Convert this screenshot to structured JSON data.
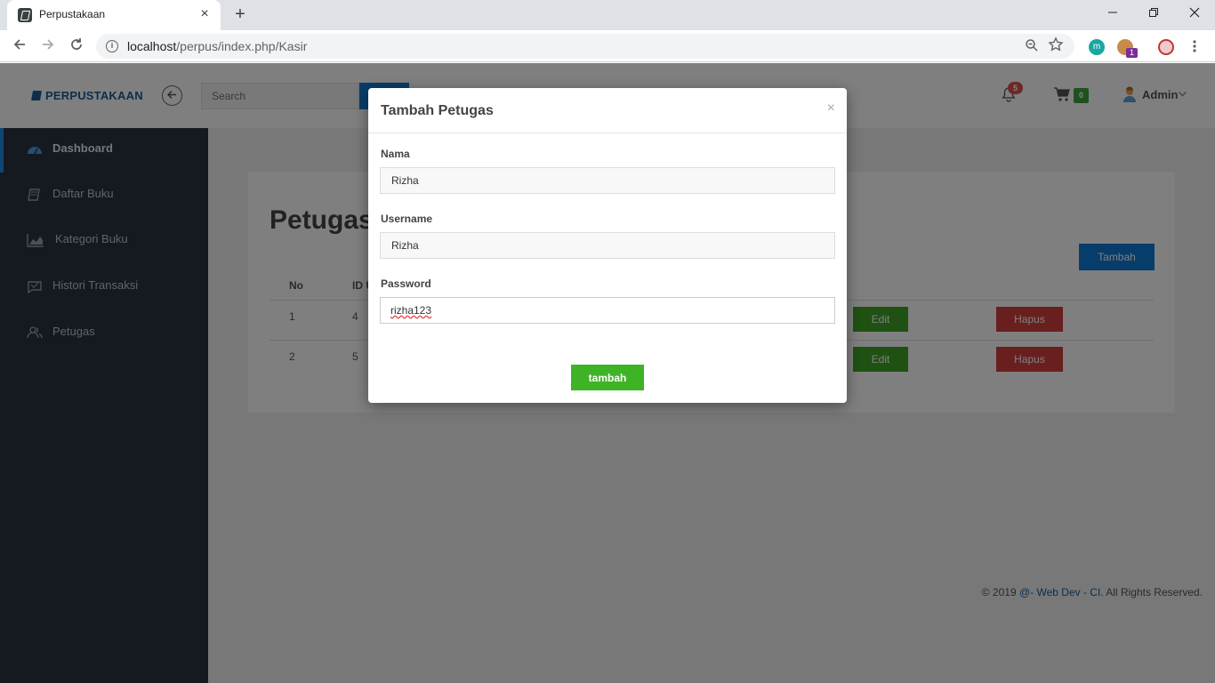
{
  "browser": {
    "tab_title": "Perpustakaan",
    "tab_close": "×",
    "new_tab": "+",
    "url_host": "localhost",
    "url_path": "/perpus/index.php/Kasir",
    "extension_badge": "1",
    "extension_letter": "m"
  },
  "header": {
    "brand": "PERPUSTAKAAN",
    "search_placeholder": "Search",
    "notification_count": "5",
    "cart_count": "0",
    "user_name": "Admin"
  },
  "sidebar": {
    "items": [
      {
        "label": "Dashboard",
        "icon": "dashboard-icon",
        "active": true
      },
      {
        "label": "Daftar Buku",
        "icon": "book-icon",
        "active": false
      },
      {
        "label": "Kategori Buku",
        "icon": "chart-area-icon",
        "active": false
      },
      {
        "label": "Histori Transaksi",
        "icon": "history-icon",
        "active": false
      },
      {
        "label": "Petugas",
        "icon": "users-icon",
        "active": false
      }
    ]
  },
  "main": {
    "page_title": "Petugas",
    "add_button": "Tambah",
    "table": {
      "headers": [
        "No",
        "ID U"
      ],
      "rows": [
        {
          "no": "1",
          "id": "4",
          "edit": "Edit",
          "hapus": "Hapus"
        },
        {
          "no": "2",
          "id": "5",
          "edit": "Edit",
          "hapus": "Hapus"
        }
      ]
    }
  },
  "footer": {
    "prefix": "© 2019 ",
    "link": "@- Web Dev - CI",
    "suffix": ". All Rights Reserved."
  },
  "modal": {
    "title": "Tambah Petugas",
    "close": "×",
    "fields": {
      "nama": {
        "label": "Nama",
        "value": "Rizha"
      },
      "username": {
        "label": "Username",
        "value": "Rizha"
      },
      "password": {
        "label": "Password",
        "value": "rizha123"
      }
    },
    "submit": "tambah"
  },
  "colors": {
    "brand_blue": "#1b5d9b",
    "primary": "#0e7bd4",
    "success": "#3ea326",
    "danger": "#d43f3f",
    "sidebar_bg": "#2a3442"
  }
}
